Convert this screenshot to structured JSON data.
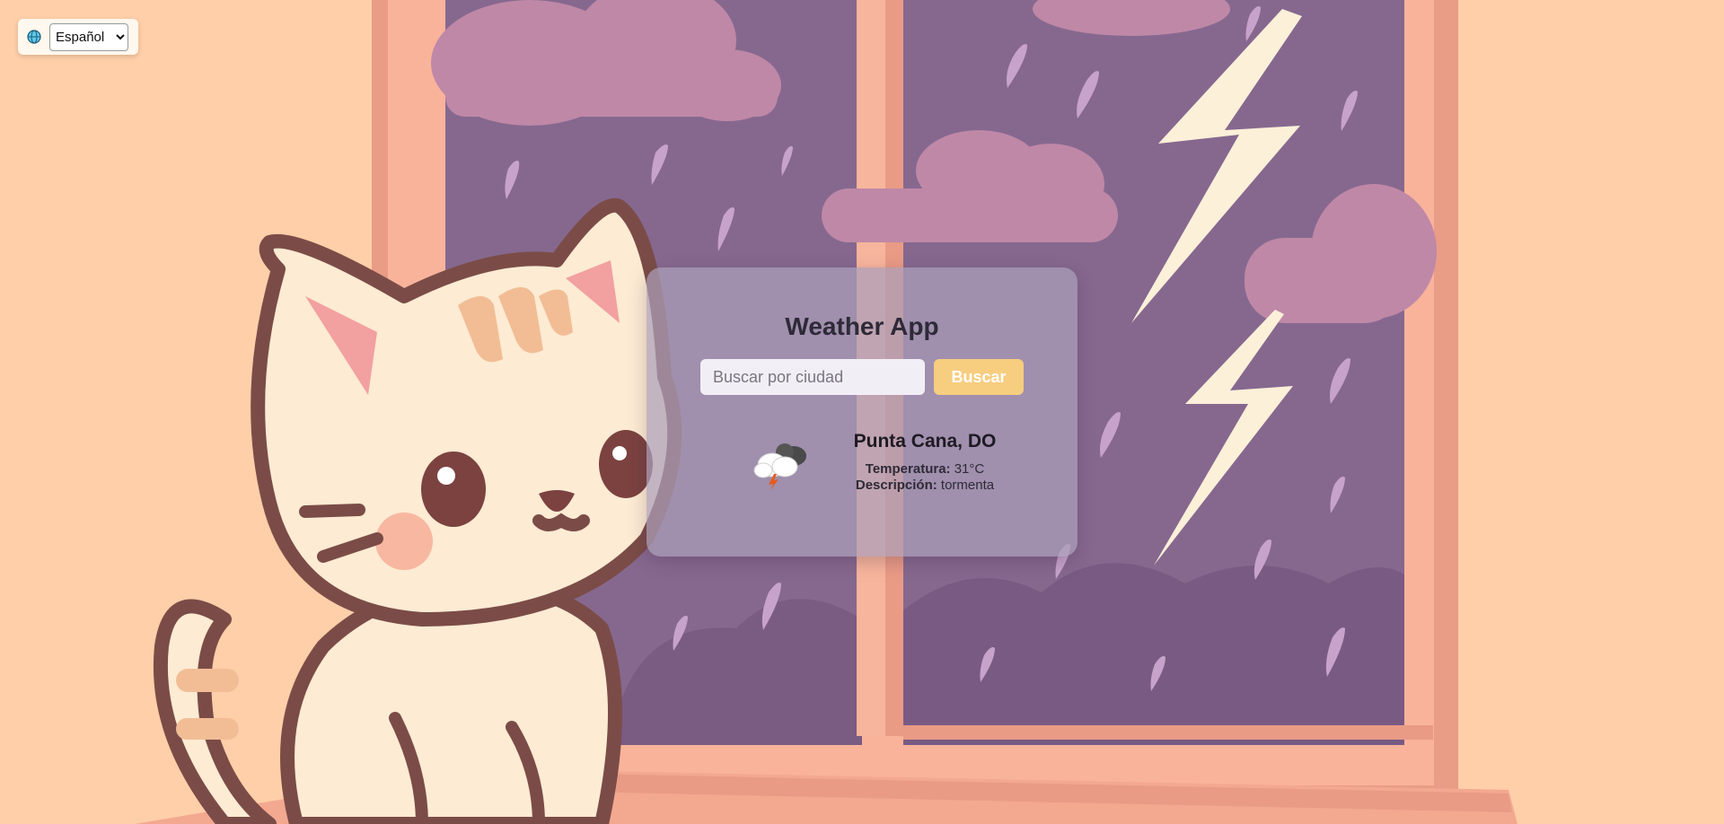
{
  "language": {
    "selected": "Español"
  },
  "app": {
    "title": "Weather App"
  },
  "search": {
    "placeholder": "Buscar por ciudad",
    "value": "",
    "button_label": "Buscar"
  },
  "weather": {
    "icon": "thunderstorm-icon",
    "city": "Punta Cana, DO",
    "temperature_label": "Temperatura:",
    "temperature_value": "31°C",
    "description_label": "Descripción:",
    "description_value": "tormenta"
  },
  "colors": {
    "card": "#aa9eb9",
    "button": "#f7cd7f",
    "page": "#fed0a8"
  }
}
